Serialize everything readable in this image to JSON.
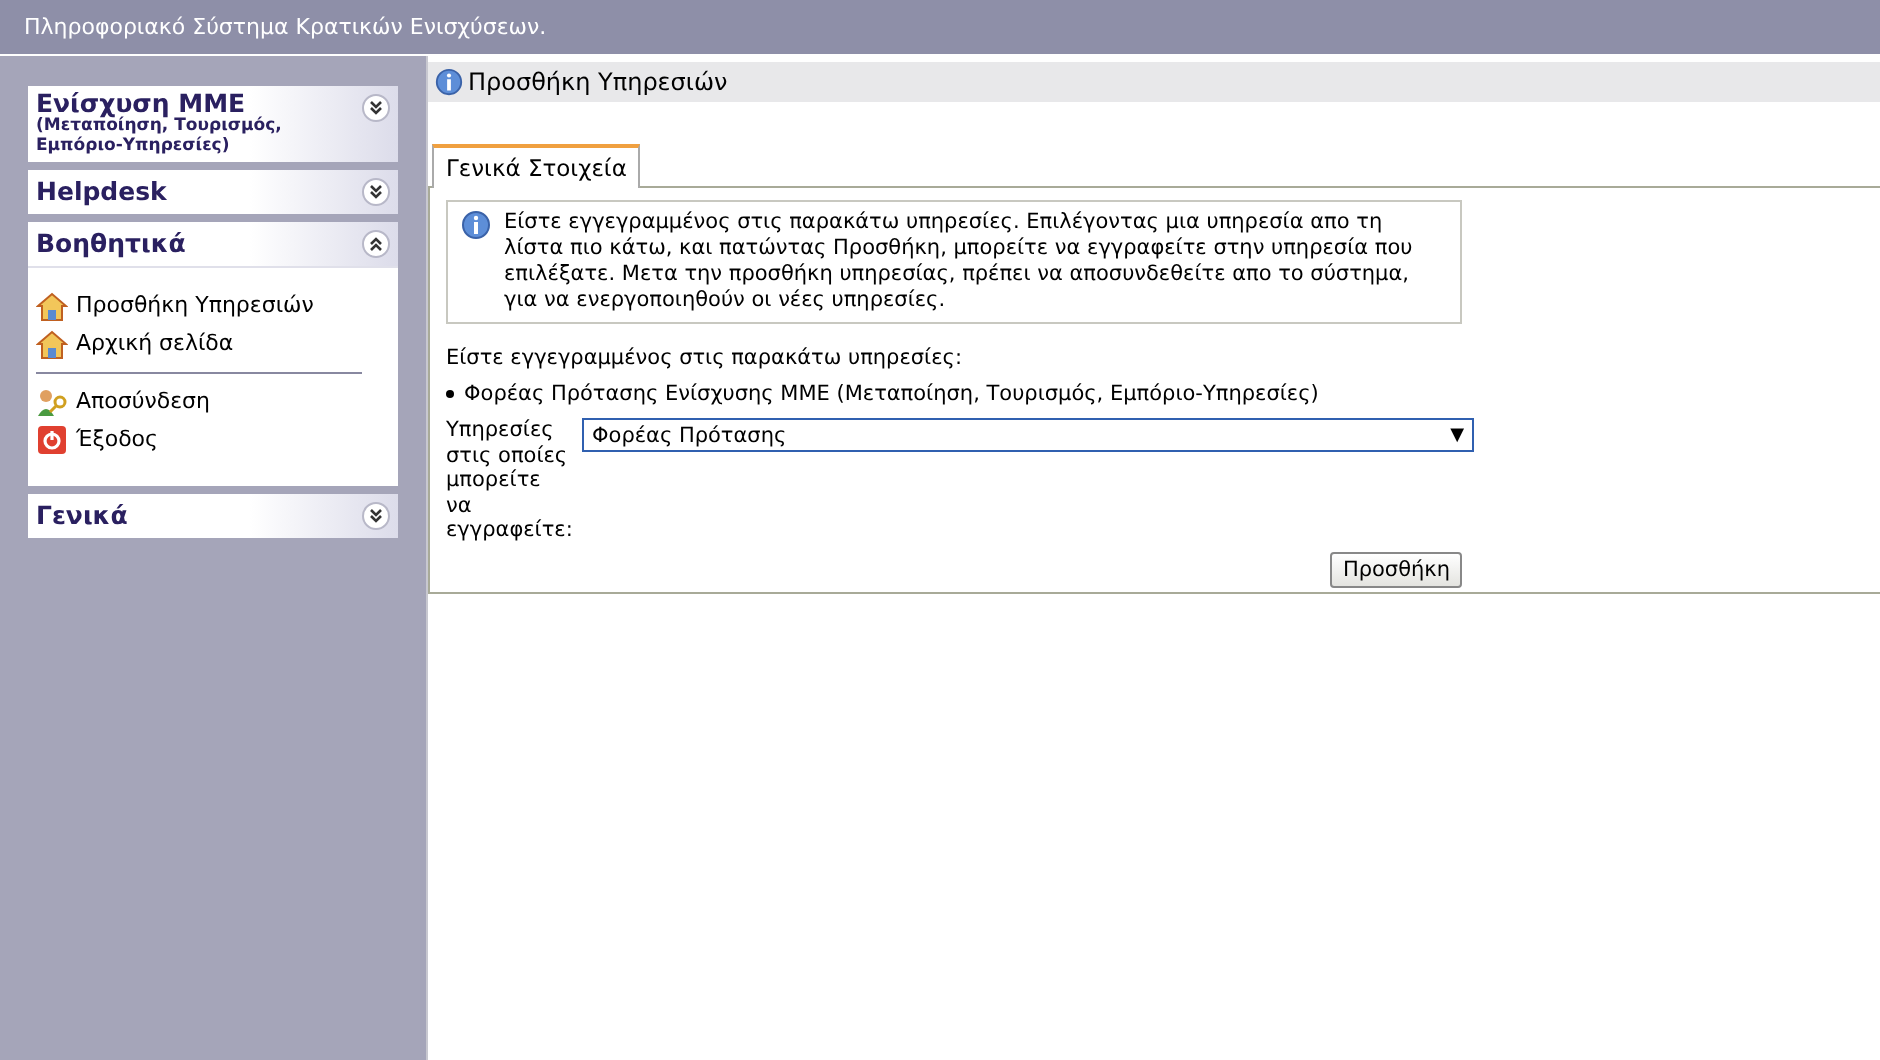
{
  "header": {
    "title": "Πληροφοριακό Σύστημα Κρατικών Ενισχύσεων."
  },
  "sidebar": {
    "panels": [
      {
        "title": "Ενίσχυση ΜΜΕ",
        "subtitle": "(Μεταποίηση, Τουρισμός, Εμπόριο-Υπηρεσίες)",
        "expanded": false
      },
      {
        "title": "Helpdesk",
        "expanded": false
      },
      {
        "title": "Βοηθητικά",
        "expanded": true,
        "groups": [
          [
            {
              "label": "Προσθήκη Υπηρεσιών",
              "kind": "home"
            },
            {
              "label": "Αρχική σελίδα",
              "kind": "home"
            }
          ],
          [
            {
              "label": "Αποσύνδεση",
              "kind": "logout"
            },
            {
              "label": "Έξοδος",
              "kind": "exit"
            }
          ]
        ]
      },
      {
        "title": "Γενικά",
        "expanded": false
      }
    ]
  },
  "page": {
    "title": "Προσθήκη Υπηρεσιών",
    "tabs": [
      {
        "label": "Γενικά Στοιχεία",
        "selected": true
      }
    ],
    "info": "Είστε εγγεγραμμένος στις παρακάτω υπηρεσίες. Επιλέγοντας μια υπηρεσία απο τη λίστα πιο κάτω, και πατώντας Προσθήκη, μπορείτε να εγγραφείτε στην υπηρεσία που επιλέξατε. Μετα την προσθήκη υπηρεσίας, πρέπει να αποσυνδεθείτε απο το σύστημα, για να ενεργοποιηθούν οι νέες υπηρεσίες.",
    "registered_label": "Είστε εγγεγραμμένος στις παρακάτω υπηρεσίες:",
    "registered": [
      "Φορέας Πρότασης Ενίσχυσης ΜΜΕ (Μεταποίηση, Τουρισμός, Εμπόριο-Υπηρεσίες)"
    ],
    "select": {
      "label": "Υπηρεσίες στις οποίες μπορείτε να εγγραφείτε:",
      "value": "Φορέας Πρότασης",
      "arrow": "▼"
    },
    "button": "Προσθήκη"
  }
}
